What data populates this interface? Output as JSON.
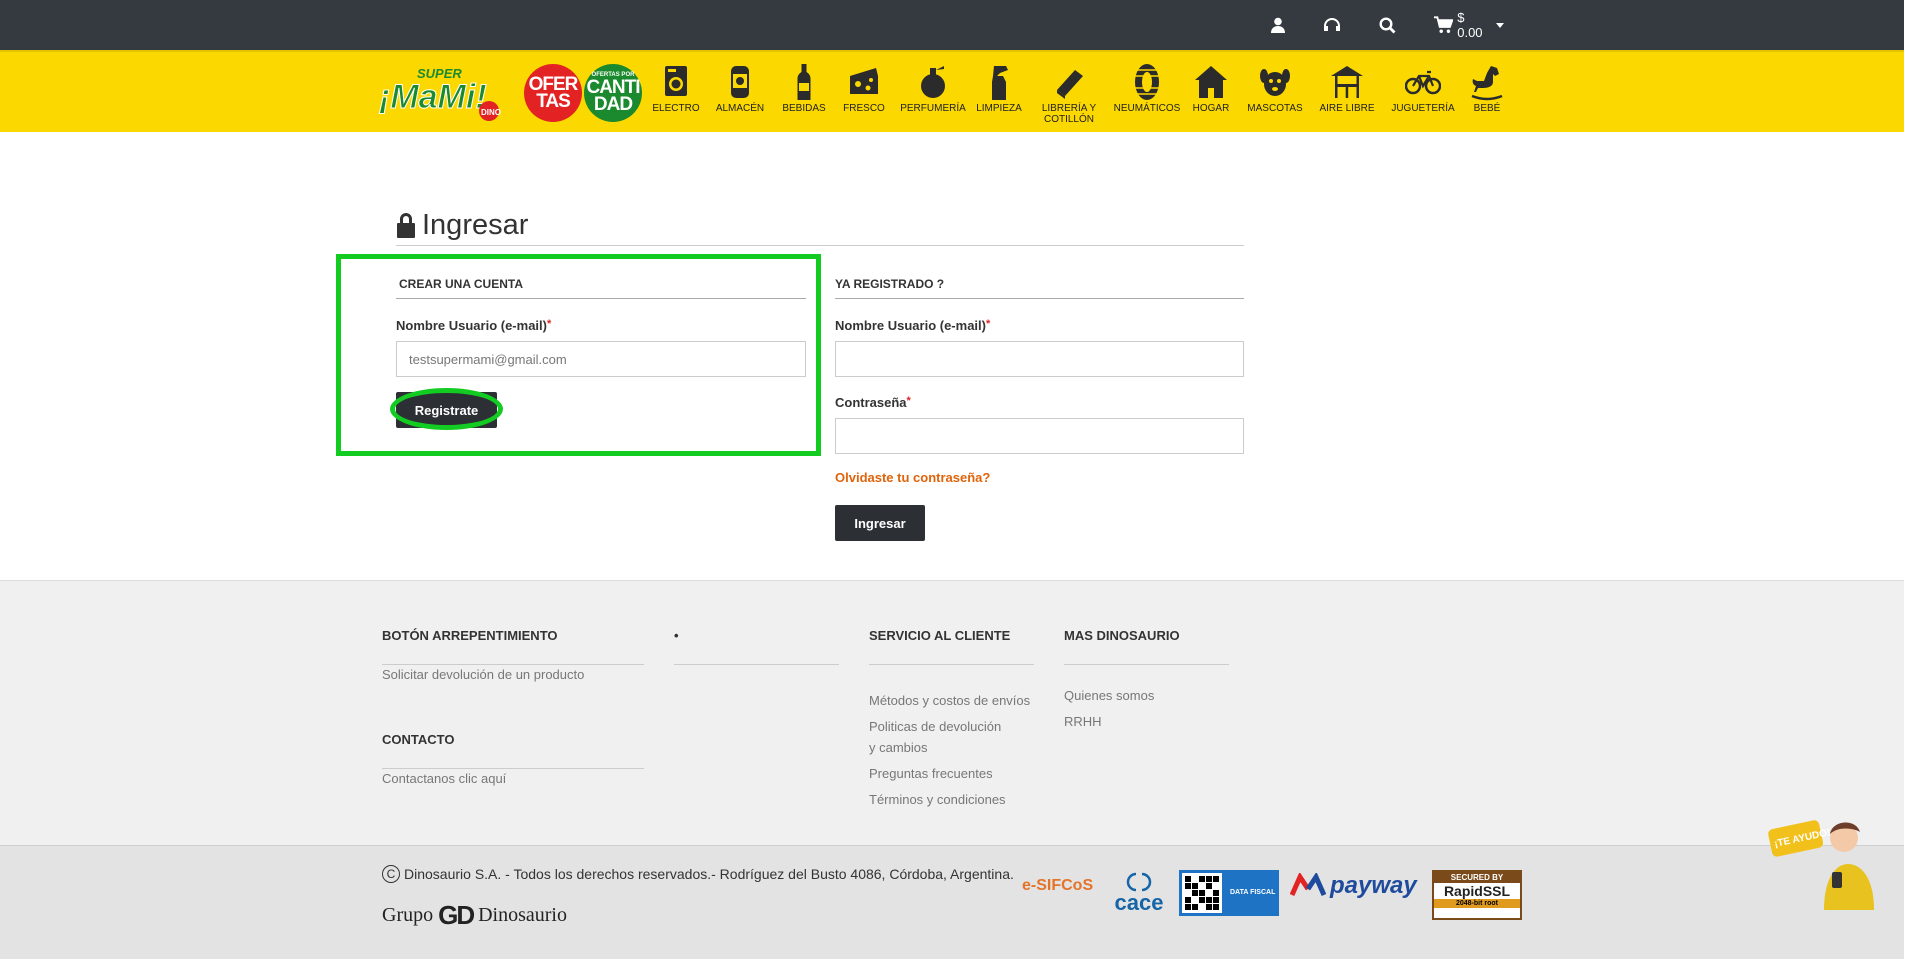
{
  "topbar": {
    "cart_amount": "$ 0.00",
    "icons": [
      "user-icon",
      "headphones-icon",
      "search-icon",
      "cart-icon"
    ]
  },
  "brand": {
    "logo_super": "SUPER",
    "logo_name": "¡MaMi!",
    "logo_dino": "DINO",
    "ofertas": [
      "OFER",
      "TAS"
    ],
    "cantidad_small": "OFERTAS POR",
    "cantidad": [
      "CANTI",
      "DAD"
    ]
  },
  "categories": [
    {
      "label": "ELECTRO",
      "icon": "washing-machine-icon"
    },
    {
      "label": "ALMACÉN",
      "icon": "can-icon"
    },
    {
      "label": "BEBIDAS",
      "icon": "bottle-icon"
    },
    {
      "label": "FRESCO",
      "icon": "cheese-icon"
    },
    {
      "label": "PERFUMERÍA",
      "icon": "perfume-icon"
    },
    {
      "label": "LIMPIEZA",
      "icon": "spray-icon"
    },
    {
      "label": "LIBRERÍA Y COTILLÓN",
      "icon": "book-icon"
    },
    {
      "label": "NEUMÁTICOS",
      "icon": "tire-icon"
    },
    {
      "label": "HOGAR",
      "icon": "house-icon"
    },
    {
      "label": "MASCOTAS",
      "icon": "dog-icon"
    },
    {
      "label": "AIRE LIBRE",
      "icon": "gazebo-icon"
    },
    {
      "label": "JUGUETERÍA",
      "icon": "bicycle-icon"
    },
    {
      "label": "BEBÉ",
      "icon": "rocking-horse-icon"
    }
  ],
  "page": {
    "title": "Ingresar"
  },
  "register": {
    "heading": "CREAR UNA CUENTA",
    "email_label": "Nombre Usuario (e-mail)",
    "required_mark": "*",
    "email_value": "",
    "email_placeholder": "testsupermami@gmail.com",
    "button": "Registrate"
  },
  "login": {
    "heading": "YA REGISTRADO ?",
    "email_label": "Nombre Usuario (e-mail)",
    "password_label": "Contraseña",
    "required_mark": "*",
    "email_value": "",
    "password_value": "",
    "forgot": "Olvidaste tu contraseña?",
    "button": "Ingresar"
  },
  "footer": {
    "col1": {
      "heading": "BOTÓN ARREPENTIMIENTO",
      "links": [
        "Solicitar devolución de un producto"
      ]
    },
    "col1b": {
      "heading": "CONTACTO",
      "links": [
        "Contactanos clic aquí"
      ]
    },
    "col2": {
      "heading": "•"
    },
    "col3": {
      "heading": "SERVICIO AL CLIENTE",
      "links": [
        "Métodos y costos de envíos",
        "Politicas de devolución y cambios",
        "Preguntas frecuentes",
        "Términos y condiciones"
      ]
    },
    "col4": {
      "heading": "MAS DINOSAURIO",
      "links": [
        "Quienes somos",
        "RRHH"
      ]
    }
  },
  "bottom": {
    "copyright_symbol": "C",
    "copyright": "Dinosaurio S.A. - Todos los derechos reservados.- Rodríguez del Busto 4086, Córdoba, Argentina.",
    "grupo_left": "Grupo",
    "grupo_mark": "GD",
    "grupo_right": "Dinosaurio",
    "esifcos": "e-SIFCoS",
    "cace": "cace",
    "datafiscal": "DATA FISCAL",
    "payway": "payway",
    "rapidssl_top": "SECURED BY",
    "rapidssl_mid": "RapidSSL",
    "rapidssl_bot": "2048-bit root"
  },
  "helper": {
    "bubble": "¡TE AYUDO!"
  },
  "colors": {
    "yellow": "#fbd800",
    "dark": "#343a40",
    "highlight": "#13cc22",
    "link_orange": "#e0630a"
  }
}
